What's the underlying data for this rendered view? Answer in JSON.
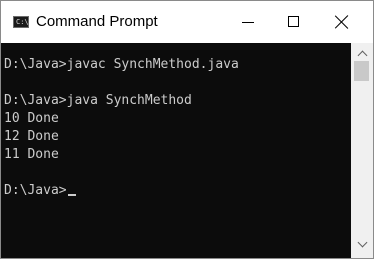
{
  "window": {
    "title": "Command Prompt",
    "icon": "cmd-icon",
    "icon_glyph": "C:\\"
  },
  "controls": {
    "minimize_icon": "minimize-icon",
    "maximize_icon": "maximize-icon",
    "close_icon": "close-icon"
  },
  "console": {
    "lines": [
      "D:\\Java>javac SynchMethod.java",
      "",
      "D:\\Java>java SynchMethod",
      "10 Done",
      "12 Done",
      "11 Done",
      "",
      "D:\\Java>"
    ],
    "foreground": "#cccccc",
    "background": "#0c0c0c"
  }
}
